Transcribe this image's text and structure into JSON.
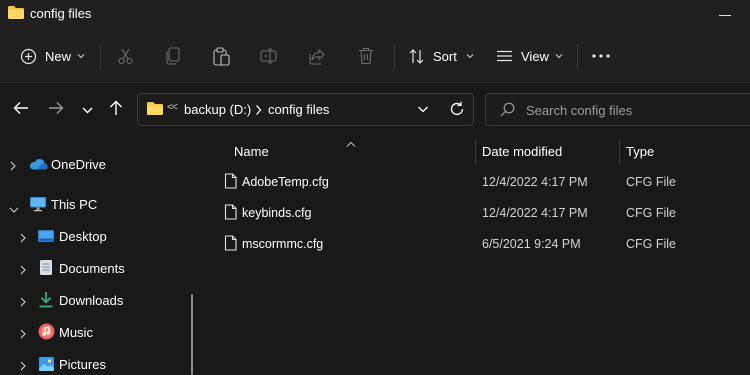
{
  "window": {
    "title": "config files"
  },
  "toolbar": {
    "new_label": "New",
    "sort_label": "Sort",
    "view_label": "View",
    "more_label": "..."
  },
  "address": {
    "overflow": "<<",
    "crumbs": [
      "backup (D:)",
      "config files"
    ]
  },
  "search": {
    "placeholder": "Search config files"
  },
  "sidebar": {
    "items": [
      {
        "label": "OneDrive",
        "icon": "cloud-icon",
        "expanded": false
      },
      {
        "label": "This PC",
        "icon": "monitor-icon",
        "expanded": true
      },
      {
        "label": "Desktop",
        "icon": "desktop-icon",
        "expanded": false
      },
      {
        "label": "Documents",
        "icon": "documents-icon",
        "expanded": false
      },
      {
        "label": "Downloads",
        "icon": "download-icon",
        "expanded": false
      },
      {
        "label": "Music",
        "icon": "music-icon",
        "expanded": false
      },
      {
        "label": "Pictures",
        "icon": "pictures-icon",
        "expanded": false
      }
    ]
  },
  "table": {
    "columns": [
      "Name",
      "Date modified",
      "Type"
    ],
    "rows": [
      {
        "name": "AdobeTemp.cfg",
        "date": "12/4/2022 4:17 PM",
        "type": "CFG File"
      },
      {
        "name": "keybinds.cfg",
        "date": "12/4/2022 4:17 PM",
        "type": "CFG File"
      },
      {
        "name": "mscormmc.cfg",
        "date": "6/5/2021 9:24 PM",
        "type": "CFG File"
      }
    ]
  },
  "colors": {
    "background": "#191919",
    "chrome": "#202020",
    "folder": "#f8c84a",
    "accent": "#4cc2ff"
  }
}
